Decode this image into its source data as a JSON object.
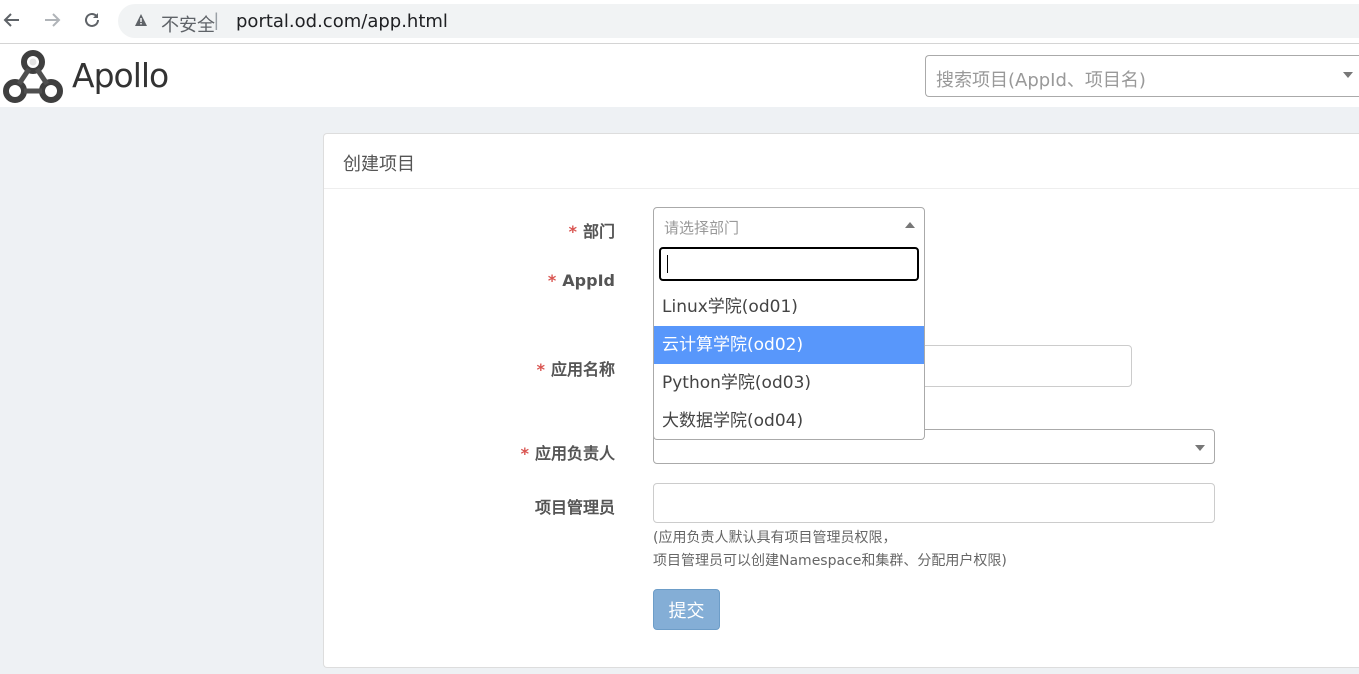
{
  "browser": {
    "security_warning": "不安全",
    "separator": "|",
    "url": "portal.od.com/app.html"
  },
  "header": {
    "logo_text": "Apollo",
    "search_placeholder": "搜索项目(AppId、项目名)"
  },
  "panel": {
    "title": "创建项目"
  },
  "form": {
    "required_mark": "*",
    "dept_label": "部门",
    "appid_label": "AppId",
    "appname_label": "应用名称",
    "owner_label": "应用负责人",
    "admin_label": "项目管理员",
    "dept_placeholder": "请选择部门",
    "dept_options": [
      "Linux学院(od01)",
      "云计算学院(od02)",
      "Python学院(od03)",
      "大数据学院(od04)"
    ],
    "highlighted_option_index": 1,
    "admin_help_line1": "(应用负责人默认具有项目管理员权限，",
    "admin_help_line2": "项目管理员可以创建Namespace和集群、分配用户权限)",
    "submit_label": "提交"
  },
  "colors": {
    "required": "#d9534f",
    "highlight": "#5897fb",
    "submit": "#84aed6"
  }
}
